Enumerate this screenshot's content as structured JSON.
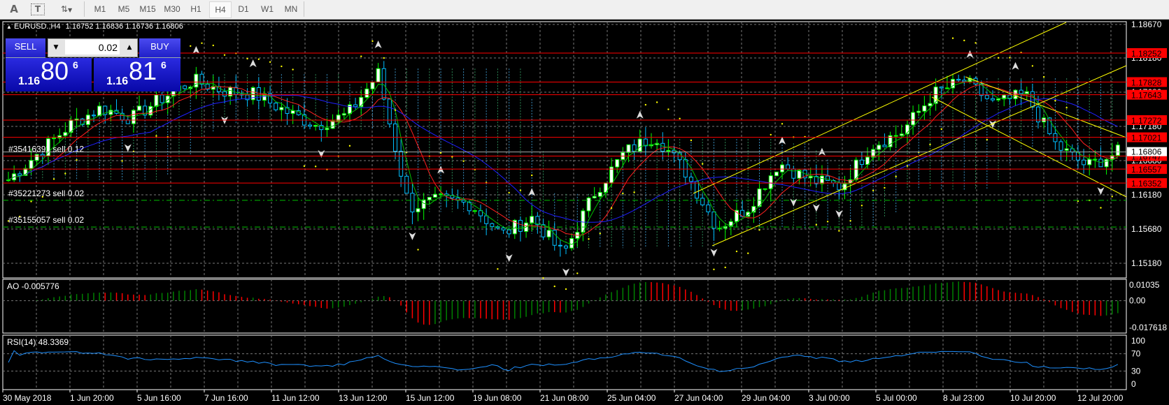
{
  "toolbar": {
    "text_tool": "A",
    "text_label_tool": "T",
    "timeframes": [
      "M1",
      "M5",
      "M15",
      "M30",
      "H1",
      "H4",
      "D1",
      "W1",
      "MN"
    ],
    "active_timeframe": "H4"
  },
  "chart_header": {
    "symbol": "EURUSD.,H4",
    "ohlc": "1.16752 1.16836 1.16736 1.16806"
  },
  "trade_panel": {
    "sell_label": "SELL",
    "buy_label": "BUY",
    "lot": "0.02",
    "sell_price": {
      "prefix": "1.16",
      "big": "80",
      "sup": "6"
    },
    "buy_price": {
      "prefix": "1.16",
      "big": "81",
      "sup": "6"
    }
  },
  "orders": [
    {
      "label": "#35416391 sell 0.12",
      "price": 1.16747
    },
    {
      "label": "#35221273 sell 0.02",
      "price": 1.161
    },
    {
      "label": "#35155057 sell 0.02",
      "price": 1.1571
    }
  ],
  "colors": {
    "bull": "#00ff00",
    "bear": "#00bfff",
    "level": "#ff0000",
    "trend": "#ffff00",
    "rsi": "#1e90ff",
    "ao_up": "#008000",
    "ao_down": "#ff0000"
  },
  "chart_data": [
    {
      "type": "candlestick",
      "symbol": "EURUSD.",
      "timeframe": "H4",
      "ylim": [
        1.1518,
        1.1867
      ],
      "y_ticks": [
        "1.18670",
        "1.18180",
        "1.17680",
        "1.17180",
        "1.16680",
        "1.16180",
        "1.15680",
        "1.15180"
      ],
      "x_ticks": [
        "30 May 2018",
        "1 Jun 20:00",
        "5 Jun 16:00",
        "7 Jun 16:00",
        "11 Jun 12:00",
        "13 Jun 12:00",
        "15 Jun 12:00",
        "19 Jun 08:00",
        "21 Jun 08:00",
        "25 Jun 04:00",
        "27 Jun 04:00",
        "29 Jun 04:00",
        "3 Jul 00:00",
        "5 Jul 00:00",
        "8 Jul 23:00",
        "10 Jul 20:00",
        "12 Jul 20:00"
      ],
      "approx_close_path": [
        1.164,
        1.168,
        1.172,
        1.1745,
        1.173,
        1.176,
        1.1785,
        1.177,
        1.1765,
        1.174,
        1.172,
        1.1735,
        1.1795,
        1.16,
        1.161,
        1.1605,
        1.156,
        1.1585,
        1.153,
        1.162,
        1.168,
        1.1705,
        1.165,
        1.157,
        1.16,
        1.1665,
        1.164,
        1.163,
        1.169,
        1.171,
        1.1765,
        1.1785,
        1.175,
        1.1765,
        1.169,
        1.166,
        1.168
      ],
      "levels": [
        "1.18252",
        "1.17828",
        "1.17643",
        "1.17272",
        "1.17021",
        "1.16747",
        "1.16557",
        "1.16352"
      ],
      "current_price": "1.16806"
    },
    {
      "type": "bar",
      "title": "AO -0.005776",
      "y_ticks": [
        "0.01035",
        "0.00",
        "-0.017618"
      ],
      "ylim": [
        -0.017618,
        0.01035
      ]
    },
    {
      "type": "line",
      "title": "RSI(14) 48.3369",
      "y_ticks": [
        "100",
        "70",
        "30",
        "0"
      ],
      "ylim": [
        0,
        100
      ]
    }
  ]
}
